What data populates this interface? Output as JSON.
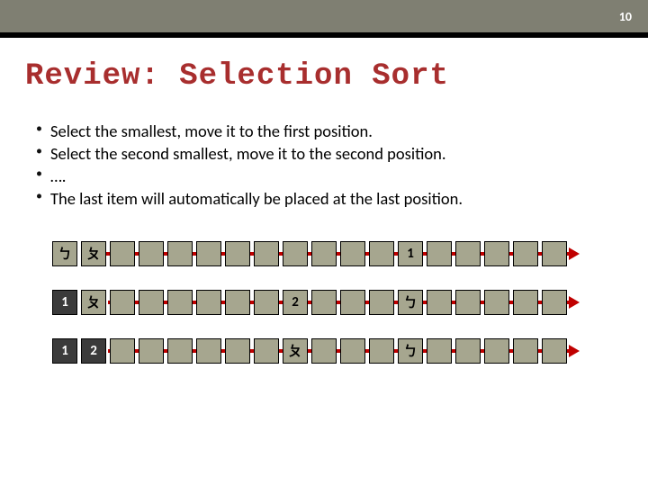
{
  "page_number": "10",
  "title": "Review: Selection Sort",
  "bullets": [
    "Select the smallest, move it to the first position.",
    "Select the second smallest, move it to the second position.",
    "….",
    "The last item will automatically be placed at the last position."
  ],
  "rows": [
    {
      "cells": [
        {
          "v": "ㄅ",
          "sorted": false
        },
        {
          "v": "ㄆ",
          "sorted": false
        },
        {
          "v": "",
          "sorted": false
        },
        {
          "v": "",
          "sorted": false
        },
        {
          "v": "",
          "sorted": false
        },
        {
          "v": "",
          "sorted": false
        },
        {
          "v": "",
          "sorted": false
        },
        {
          "v": "",
          "sorted": false
        },
        {
          "v": "",
          "sorted": false
        },
        {
          "v": "",
          "sorted": false
        },
        {
          "v": "",
          "sorted": false
        },
        {
          "v": "",
          "sorted": false
        },
        {
          "v": "1",
          "sorted": false
        },
        {
          "v": "",
          "sorted": false
        },
        {
          "v": "",
          "sorted": false
        },
        {
          "v": "",
          "sorted": false
        },
        {
          "v": "",
          "sorted": false
        },
        {
          "v": "",
          "sorted": false
        }
      ],
      "arrow_class": "a1"
    },
    {
      "cells": [
        {
          "v": "1",
          "sorted": true
        },
        {
          "v": "ㄆ",
          "sorted": false
        },
        {
          "v": "",
          "sorted": false
        },
        {
          "v": "",
          "sorted": false
        },
        {
          "v": "",
          "sorted": false
        },
        {
          "v": "",
          "sorted": false
        },
        {
          "v": "",
          "sorted": false
        },
        {
          "v": "",
          "sorted": false
        },
        {
          "v": "2",
          "sorted": false
        },
        {
          "v": "",
          "sorted": false
        },
        {
          "v": "",
          "sorted": false
        },
        {
          "v": "",
          "sorted": false
        },
        {
          "v": "ㄅ",
          "sorted": false
        },
        {
          "v": "",
          "sorted": false
        },
        {
          "v": "",
          "sorted": false
        },
        {
          "v": "",
          "sorted": false
        },
        {
          "v": "",
          "sorted": false
        },
        {
          "v": "",
          "sorted": false
        }
      ],
      "arrow_class": "a2"
    },
    {
      "cells": [
        {
          "v": "1",
          "sorted": true
        },
        {
          "v": "2",
          "sorted": true
        },
        {
          "v": "",
          "sorted": false
        },
        {
          "v": "",
          "sorted": false
        },
        {
          "v": "",
          "sorted": false
        },
        {
          "v": "",
          "sorted": false
        },
        {
          "v": "",
          "sorted": false
        },
        {
          "v": "",
          "sorted": false
        },
        {
          "v": "ㄆ",
          "sorted": false
        },
        {
          "v": "",
          "sorted": false
        },
        {
          "v": "",
          "sorted": false
        },
        {
          "v": "",
          "sorted": false
        },
        {
          "v": "ㄅ",
          "sorted": false
        },
        {
          "v": "",
          "sorted": false
        },
        {
          "v": "",
          "sorted": false
        },
        {
          "v": "",
          "sorted": false
        },
        {
          "v": "",
          "sorted": false
        },
        {
          "v": "",
          "sorted": false
        }
      ],
      "arrow_class": "a3"
    }
  ]
}
